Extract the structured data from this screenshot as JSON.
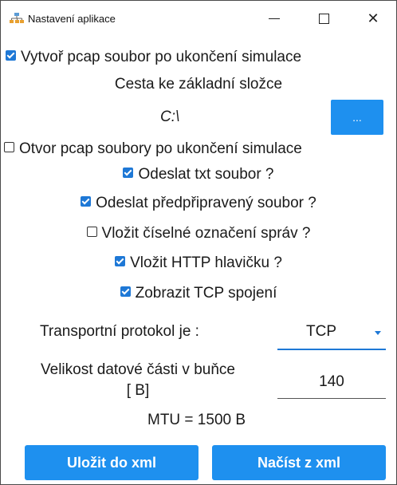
{
  "window": {
    "title": "Nastavení aplikace"
  },
  "settings": {
    "create_pcap": {
      "label": "Vytvoř pcap soubor po ukončení simulace",
      "checked": true
    },
    "base_folder_label": "Cesta ke základní složce",
    "base_folder_value": "C:\\",
    "browse_label": "...",
    "open_pcap": {
      "label": "Otvor pcap soubory po ukončení simulace",
      "checked": false
    },
    "send_txt": {
      "label": "Odeslat txt soubor ?",
      "checked": true
    },
    "send_prepared": {
      "label": "Odeslat předpřipravený soubor ?",
      "checked": true
    },
    "insert_numbering": {
      "label": "Vložit číselné označení správ ?",
      "checked": false
    },
    "insert_http": {
      "label": "Vložit HTTP hlavičku ?",
      "checked": true
    },
    "show_tcp": {
      "label": "Zobrazit TCP spojení",
      "checked": true
    },
    "transport_label": "Transportní protokol je :",
    "transport_value": "TCP",
    "cell_size_label_line1": "Velikost datové části v buňce",
    "cell_size_label_line2": "[ B]",
    "cell_size_value": "140",
    "mtu_text": "MTU = 1500 B"
  },
  "buttons": {
    "save_xml": "Uložit do xml",
    "load_xml": "Načíst z xml"
  },
  "colors": {
    "accent": "#1e90ef",
    "check": "#1e78d6"
  }
}
